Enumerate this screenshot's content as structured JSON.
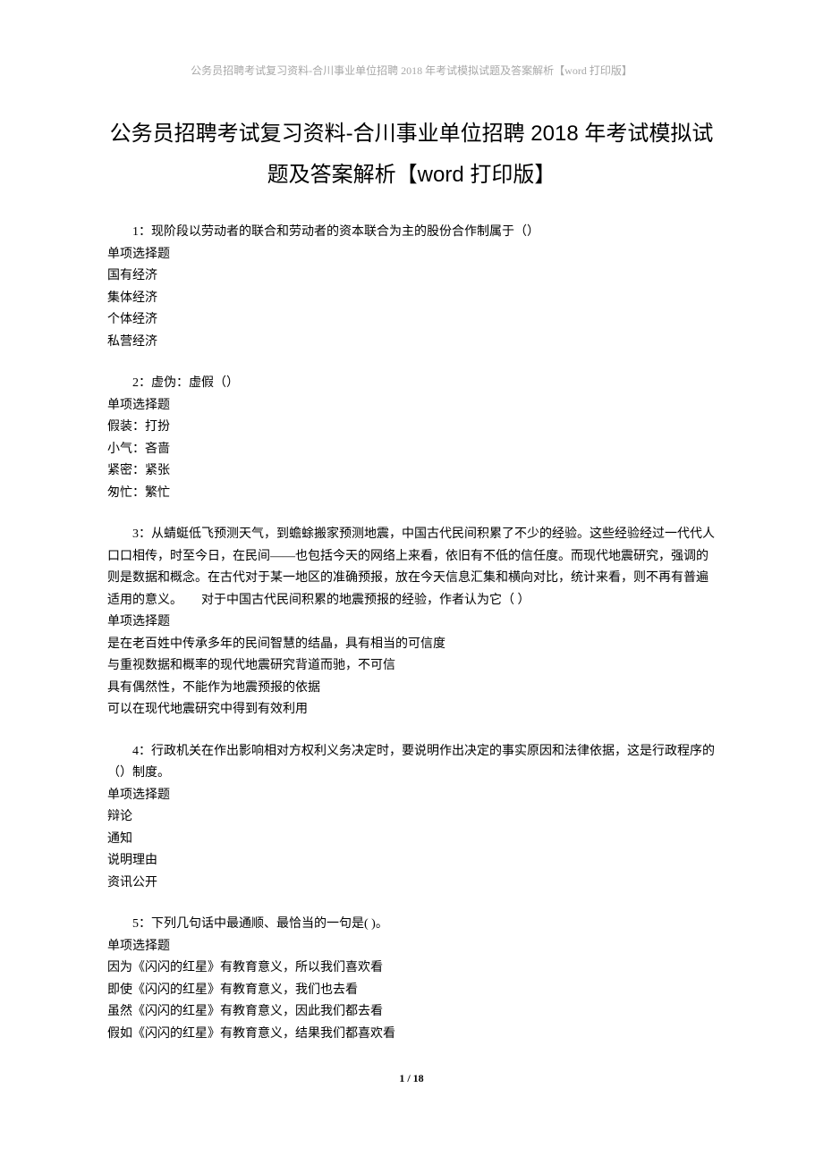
{
  "header": "公务员招聘考试复习资料-合川事业单位招聘 2018 年考试模拟试题及答案解析【word 打印版】",
  "title": "公务员招聘考试复习资料-合川事业单位招聘 2018 年考试模拟试题及答案解析【word 打印版】",
  "questions": [
    {
      "stem": "1：现阶段以劳动者的联合和劳动者的资本联合为主的股份合作制属于（）",
      "type": "单项选择题",
      "options": [
        "国有经济",
        "集体经济",
        "个体经济",
        "私营经济"
      ]
    },
    {
      "stem": "2：虚伪：虚假（）",
      "type": "单项选择题",
      "options": [
        "假装：打扮",
        "小气：吝啬",
        "紧密：紧张",
        "匆忙：繁忙"
      ]
    },
    {
      "stem": "3：从蜻蜓低飞预测天气，到蟾蜍搬家预测地震，中国古代民间积累了不少的经验。这些经验经过一代代人口口相传，时至今日，在民间——也包括今天的网络上来看，依旧有不低的信任度。而现代地震研究，强调的则是数据和概念。在古代对于某一地区的准确预报，放在今天信息汇集和横向对比，统计来看，则不再有普遍适用的意义。　　对于中国古代民间积累的地震预报的经验，作者认为它（  ）",
      "type": "单项选择题",
      "options": [
        "是在老百姓中传承多年的民间智慧的结晶，具有相当的可信度",
        "与重视数据和概率的现代地震研究背道而驰，不可信",
        "具有偶然性，不能作为地震预报的依据",
        "可以在现代地震研究中得到有效利用"
      ]
    },
    {
      "stem": "4：行政机关在作出影响相对方权利义务决定时，要说明作出决定的事实原因和法律依据，这是行政程序的（）制度。",
      "type": "单项选择题",
      "options": [
        "辩论",
        "通知",
        "说明理由",
        "资讯公开"
      ]
    },
    {
      "stem": "5：下列几句话中最通顺、最恰当的一句是( )。",
      "type": "单项选择题",
      "options": [
        "因为《闪闪的红星》有教育意义，所以我们喜欢看",
        "即使《闪闪的红星》有教育意义，我们也去看",
        "虽然《闪闪的红星》有教育意义，因此我们都去看",
        "假如《闪闪的红星》有教育意义，结果我们都喜欢看"
      ]
    }
  ],
  "footer": "1 / 18"
}
